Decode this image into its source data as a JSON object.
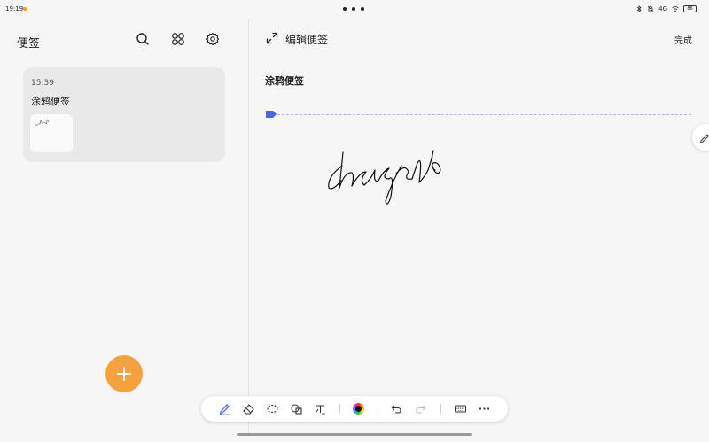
{
  "status_bar": {
    "time": "19:19",
    "signal_text": "4G",
    "battery": "86"
  },
  "left_panel": {
    "app_title": "便签",
    "icons": [
      "search-icon",
      "grid-icon",
      "settings-icon"
    ],
    "note_card": {
      "time": "15:39",
      "title": "涂鸦便签"
    },
    "fab_icon": "plus-icon"
  },
  "right_panel": {
    "header_title": "编辑便签",
    "done_label": "完成",
    "note_heading": "涂鸦便签"
  },
  "toolbar": {
    "tools": [
      "pen-icon",
      "eraser-icon",
      "lasso-icon",
      "shapes-icon",
      "text-icon",
      "color-picker",
      "undo-icon",
      "redo-icon",
      "keyboard-icon",
      "more-icon"
    ],
    "current_color": "#111111",
    "active_tool": "pen-icon"
  },
  "colors": {
    "accent": "#f5a13e",
    "pen_active": "#4f63e8",
    "background": "#f6f6f6"
  }
}
